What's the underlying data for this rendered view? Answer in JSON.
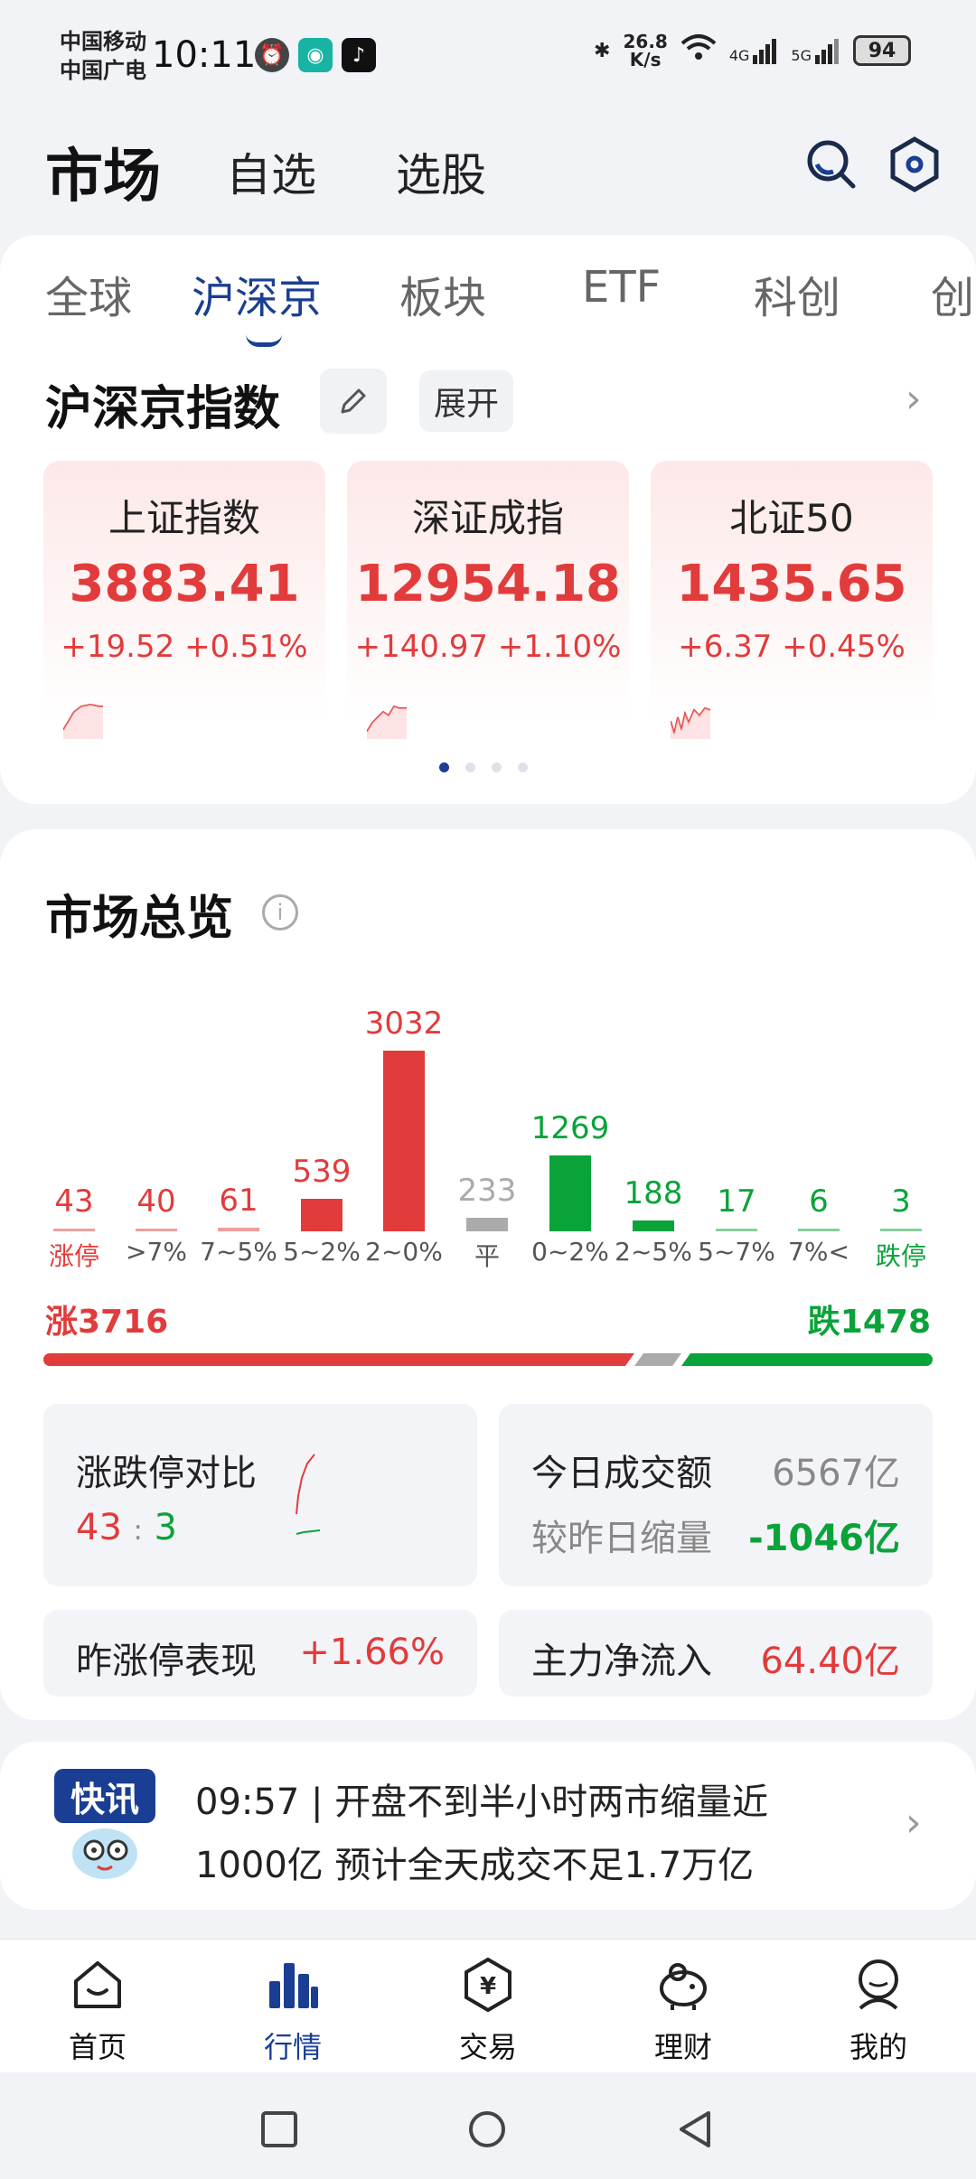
{
  "status_bar": {
    "carrier1": "中国移动",
    "carrier2": "中国广电",
    "time": "10:11",
    "net_speed_value": "26.8",
    "net_speed_unit": "K/s",
    "signal1": "4G",
    "signal2": "5G",
    "battery": "94"
  },
  "header": {
    "title": "市场",
    "tabs": [
      "自选",
      "选股"
    ]
  },
  "sub_tabs": [
    "全球",
    "沪深京",
    "板块",
    "ETF",
    "科创",
    "创"
  ],
  "index_section": {
    "title": "沪深京指数",
    "expand_label": "展开",
    "cards": [
      {
        "name": "上证指数",
        "value": "3883.41",
        "change": "+19.52",
        "pct": "+0.51%"
      },
      {
        "name": "深证成指",
        "value": "12954.18",
        "change": "+140.97",
        "pct": "+1.10%"
      },
      {
        "name": "北证50",
        "value": "1435.65",
        "change": "+6.37",
        "pct": "+0.45%"
      }
    ]
  },
  "overview": {
    "title": "市场总览",
    "info_glyph": "i",
    "buckets": [
      {
        "label": "涨停",
        "count": "43"
      },
      {
        "label": ">7%",
        "count": "40"
      },
      {
        "label": "7~5%",
        "count": "61"
      },
      {
        "label": "5~2%",
        "count": "539"
      },
      {
        "label": "2~0%",
        "count": "3032"
      },
      {
        "label": "平",
        "count": "233"
      },
      {
        "label": "0~2%",
        "count": "1269"
      },
      {
        "label": "2~5%",
        "count": "188"
      },
      {
        "label": "5~7%",
        "count": "17"
      },
      {
        "label": "7%<",
        "count": "6"
      },
      {
        "label": "跌停",
        "count": "3"
      }
    ],
    "up_label": "涨3716",
    "down_label": "跌1478",
    "limit_compare": {
      "title": "涨跌停对比",
      "up": "43",
      "sep": ":",
      "down": "3"
    },
    "turnover": {
      "title": "今日成交额",
      "value": "6567亿",
      "compare_title": "较昨日缩量",
      "compare_value": "-1046亿"
    },
    "yesterday_limit": {
      "title": "昨涨停表现",
      "value": "+1.66%"
    },
    "main_inflow": {
      "title": "主力净流入",
      "value": "64.40亿"
    }
  },
  "news": {
    "logo_text": "快讯",
    "time": "09:57",
    "headline": "开盘不到半小时两市缩量近1000亿 预计全天成交不足1.7万亿"
  },
  "bottom_nav": [
    {
      "label": "首页",
      "icon": "home-icon"
    },
    {
      "label": "行情",
      "icon": "market-icon"
    },
    {
      "label": "交易",
      "icon": "trade-icon"
    },
    {
      "label": "理财",
      "icon": "wealth-icon"
    },
    {
      "label": "我的",
      "icon": "profile-icon"
    }
  ],
  "chart_data": {
    "type": "bar",
    "categories": [
      "涨停",
      ">7%",
      "7~5%",
      "5~2%",
      "2~0%",
      "平",
      "0~2%",
      "2~5%",
      "5~7%",
      "7%<",
      "跌停"
    ],
    "values": [
      43,
      40,
      61,
      539,
      3032,
      233,
      1269,
      188,
      17,
      6,
      3
    ],
    "colors": [
      "#e23b3b",
      "#e23b3b",
      "#e23b3b",
      "#e23b3b",
      "#e23b3b",
      "#aaaaaa",
      "#0aa33a",
      "#0aa33a",
      "#0aa33a",
      "#0aa33a",
      "#0aa33a"
    ]
  },
  "colors": {
    "up": "#e23b3b",
    "down": "#0aa33a",
    "accent": "#1a3e93",
    "flat": "#aaaaaa"
  }
}
